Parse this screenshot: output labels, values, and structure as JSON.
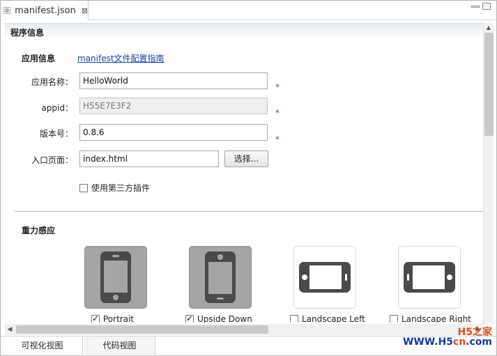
{
  "tab": {
    "filename": "manifest.json",
    "close": "⊠"
  },
  "section": {
    "title": "程序信息"
  },
  "app_info": {
    "label": "应用信息",
    "guide_link": "manifest文件配置指南",
    "name_label": "应用名称：",
    "name_value": "HelloWorld",
    "appid_label": "appid：",
    "appid_value": "H55E7E3F2",
    "version_label": "版本号：",
    "version_value": "0.8.6",
    "entry_label": "入口页面：",
    "entry_value": "index.html",
    "choose_button": "选择...",
    "plugin_checkbox": "使用第三方插件",
    "required_mark": "*"
  },
  "gravity": {
    "label": "重力感应",
    "options": [
      {
        "label": "Portrait",
        "checked": true
      },
      {
        "label": "Upside Down",
        "checked": true
      },
      {
        "label": "Landscape Left",
        "checked": false
      },
      {
        "label": "Landscape Right",
        "checked": false
      }
    ]
  },
  "bottom_tabs": [
    "可视化视图",
    "代码视图"
  ],
  "watermark": {
    "top": "H5之家",
    "bottom_prefix": "WWW.H5",
    "bottom_cn": "cn",
    "bottom_suffix": ".com"
  },
  "colors": {
    "link": "#1b3fa8",
    "tile_selected": "#a5a5a5",
    "phone": "#4a4a4a"
  }
}
